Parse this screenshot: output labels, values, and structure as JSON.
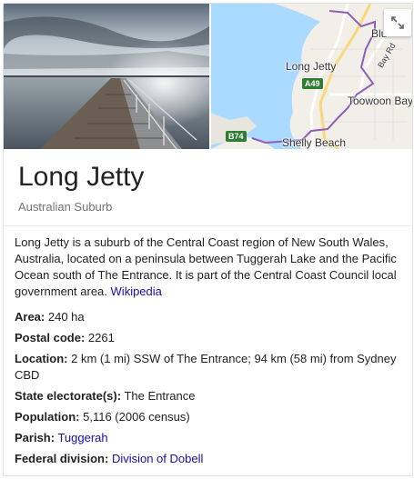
{
  "media": {
    "photo_alt": "Long Jetty pier photo",
    "map_labels": {
      "long_jetty": "Long Jetty",
      "toowoon_bay": "Toowoon Bay",
      "shelly_beach": "Shelly Beach",
      "blue_bay": "Blu",
      "bay_rd": "Bay Rd",
      "a49": "A49",
      "b74": "B74"
    }
  },
  "header": {
    "title": "Long Jetty",
    "subtitle": "Australian Suburb"
  },
  "description": {
    "text": "Long Jetty is a suburb of the Central Coast region of New South Wales, Australia, located on a peninsula between Tuggerah Lake and the Pacific Ocean south of The Entrance. It is part of the Central Coast Council local government area.",
    "source_link": "Wikipedia"
  },
  "facts": [
    {
      "label": "Area:",
      "value": "240 ha"
    },
    {
      "label": "Postal code:",
      "value": "2261"
    },
    {
      "label": "Location:",
      "value": "2 km (1 mi) SSW of The Entrance; 94 km (58 mi) from Sydney CBD"
    },
    {
      "label": "State electorate(s):",
      "value": "The Entrance"
    },
    {
      "label": "Population:",
      "value": "5,116 (2006 census)"
    },
    {
      "label": "Parish:",
      "value": "Tuggerah",
      "link": true
    },
    {
      "label": "Federal division:",
      "value": "Division of Dobell",
      "link": true
    }
  ],
  "colors": {
    "link": "#1a0dab",
    "subtitle": "#70757a",
    "water": "#aadaff",
    "land": "#f2efe9",
    "boundary": "#8e5fb8"
  }
}
